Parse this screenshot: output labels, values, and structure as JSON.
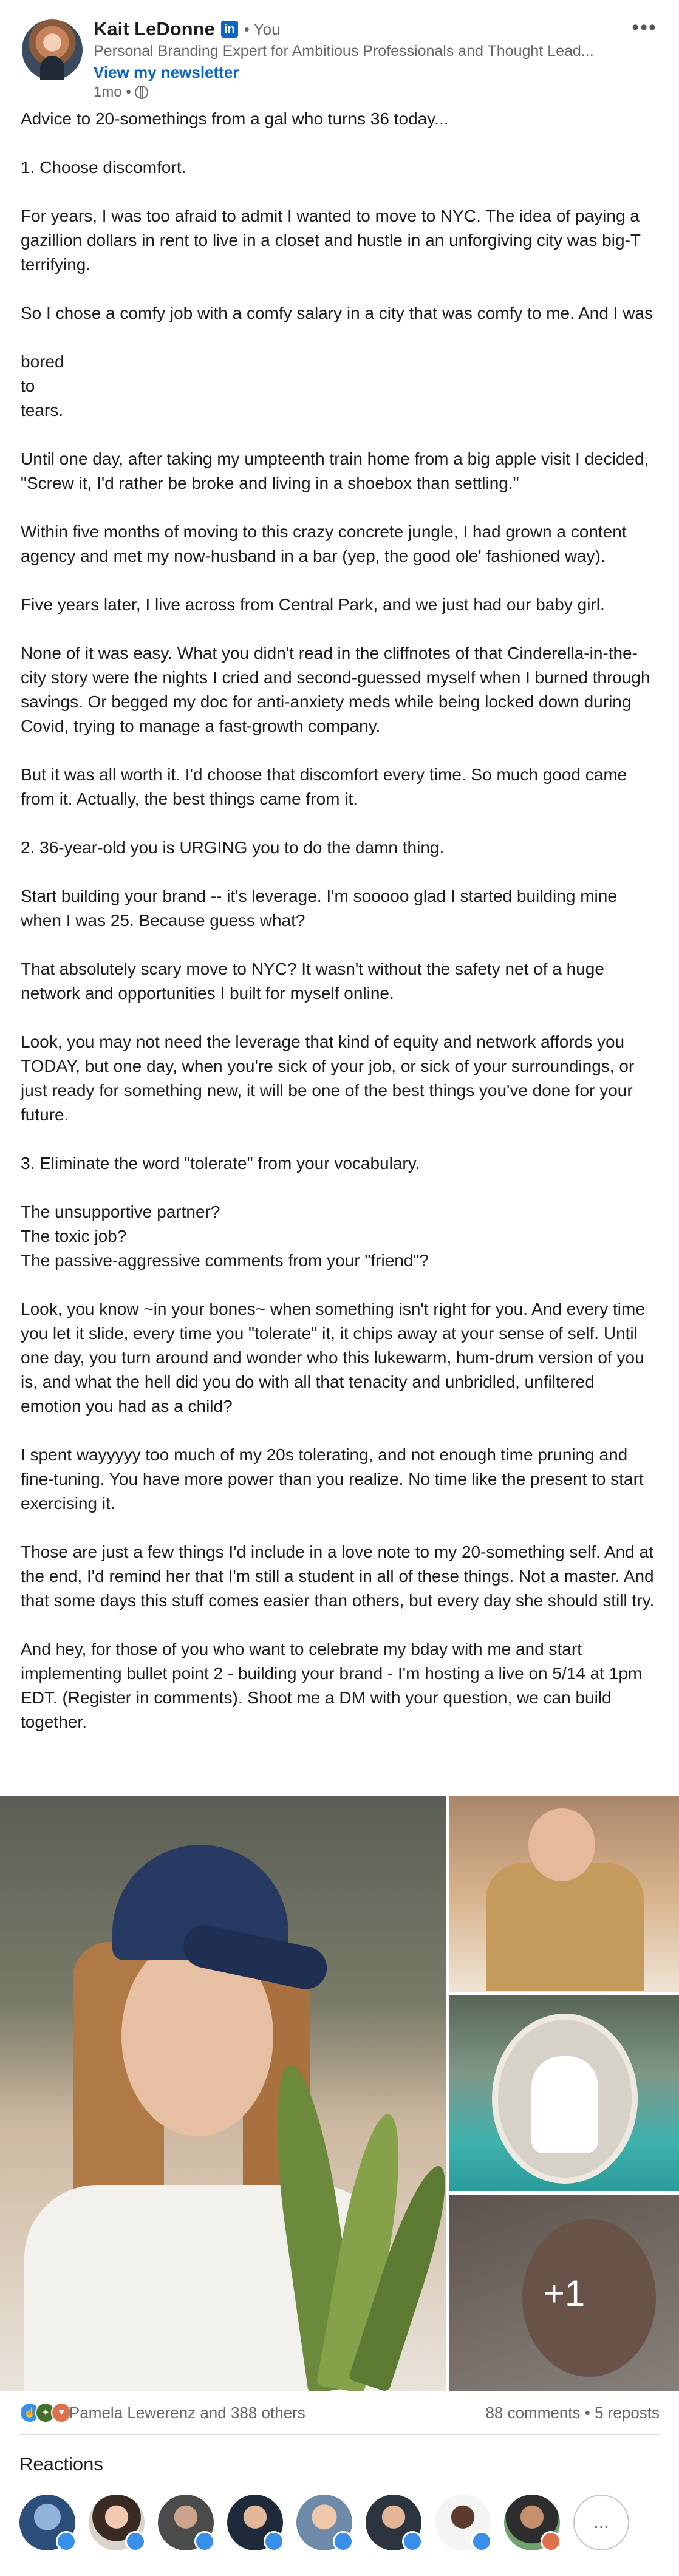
{
  "post": {
    "author": {
      "name": "Kait LeDonne",
      "linkedin_badge": "in",
      "degree": "• You",
      "headline": "Personal Branding Expert for Ambitious Professionals and Thought Lead...",
      "newsletter_link": "View my newsletter",
      "timestamp": "1mo •",
      "visibility_icon": "globe-icon"
    },
    "more_menu": "•••",
    "paragraphs": [
      "Advice to 20-somethings from a gal who turns 36 today...",
      "1. Choose discomfort.",
      "For years, I was too afraid to admit I wanted to move to NYC. The idea of paying a gazillion dollars in rent to live in a closet and hustle in an unforgiving city was big-T terrifying.",
      "So I chose a comfy job with a comfy salary in a city that was comfy to me. And I was",
      "bored\nto\ntears.",
      "Until one day, after taking my umpteenth train home from a big apple visit I decided, \"Screw it, I'd rather be broke and living in a shoebox than settling.\"",
      "Within five months of moving to this crazy concrete jungle, I had grown a content agency and met my now-husband in a bar (yep, the good ole' fashioned way).",
      "Five years later, I live across from Central Park, and we just had our baby girl.",
      "None of it was easy. What you didn't read in the cliffnotes of that Cinderella-in-the-city story were the nights I cried and second-guessed myself when I burned through savings. Or begged my doc for anti-anxiety meds while being locked down during Covid, trying to manage a fast-growth company.",
      "But it was all worth it. I'd choose that discomfort every time. So much good came from it. Actually, the best things came from it.",
      "2. 36-year-old you is URGING you to do the damn thing.",
      "Start building your brand -- it's leverage. I'm sooooo glad I started building mine when I was 25. Because guess what?",
      "That absolutely scary move to NYC? It wasn't without the safety net of a huge network and opportunities I built for myself online.",
      "Look, you may not need the leverage that kind of equity and network affords you TODAY, but one day, when you're sick of your job, or sick of your surroundings, or just ready for something new, it will be one of the best things you've done for your future.",
      "3. Eliminate the word \"tolerate\" from your vocabulary.",
      "The unsupportive partner?\nThe toxic job?\nThe passive-aggressive comments from your \"friend\"?",
      "Look, you know ~in your bones~ when something isn't right for you. And every time you let it slide, every time you \"tolerate\" it, it chips away at your sense of self. Until one day, you turn around and wonder who this lukewarm, hum-drum version of you is, and what the hell did you do with all that tenacity and unbridled, unfiltered emotion you had as a child?",
      "I spent wayyyyy too much of my 20s tolerating, and not enough time pruning and fine-tuning. You have more power than you realize. No time like the present to start exercising it.",
      "Those are just a few things I'd include in a love note to my 20-something self. And at the end, I'd remind her that I'm still a student in all of these things. Not a master. And that some days this stuff comes easier than others, but every day she should still try.",
      "And hey, for those of you who want to celebrate my bday with me and start implementing bullet point 2 - building your brand - I'm hosting a live on 5/14 at 1pm EDT. (Register in comments). Shoot me a DM with your question, we can build together."
    ],
    "photos": {
      "more_count": "+1"
    },
    "social": {
      "reactors_text": "Pamela Lewerenz and 388 others",
      "counts_text": "88 comments • 5 reposts"
    },
    "reactions": {
      "title": "Reactions",
      "more_label": "..."
    }
  },
  "colors": {
    "accent": "#0a66c2",
    "like": "#378fe9",
    "love": "#df704d",
    "celebrate": "#44712e"
  }
}
